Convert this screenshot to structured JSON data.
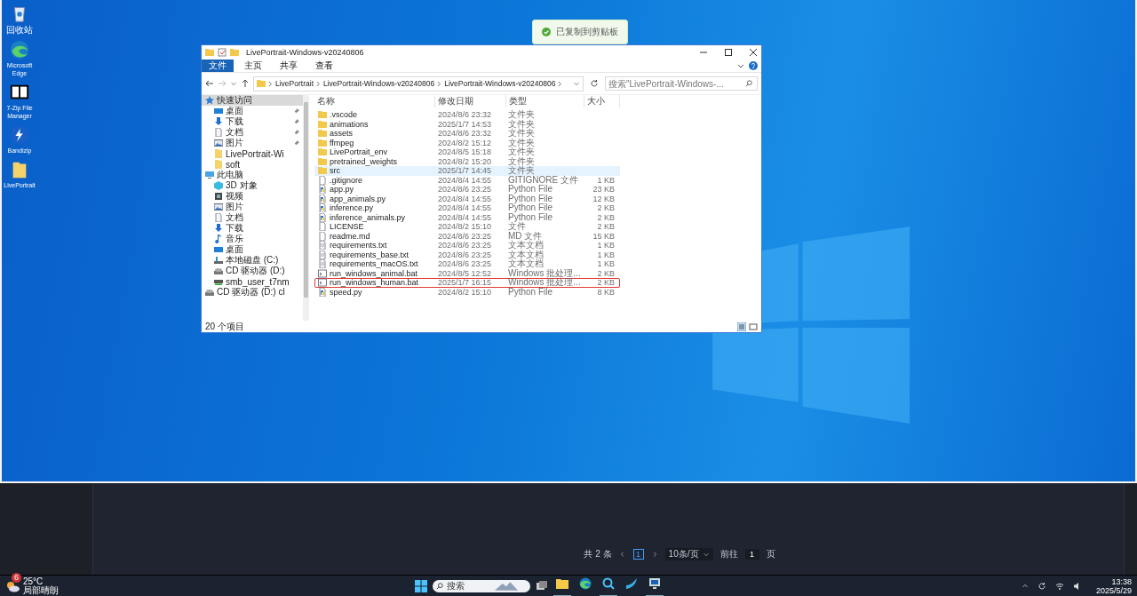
{
  "toast": {
    "text": "已复制到剪贴板"
  },
  "desktop_icons": [
    {
      "kind": "recycle",
      "label": "回收站"
    },
    {
      "kind": "edge",
      "label": "Microsoft Edge"
    },
    {
      "kind": "zip",
      "label": "7-Zip File Manager"
    },
    {
      "kind": "bandizip",
      "label": "Bandizip"
    },
    {
      "kind": "folder",
      "label": "LivePortrait"
    }
  ],
  "window": {
    "title": "LivePortrait-Windows-v20240806",
    "tabs": [
      {
        "label": "文件",
        "selected": true
      },
      {
        "label": "主页",
        "selected": false
      },
      {
        "label": "共享",
        "selected": false
      },
      {
        "label": "查看",
        "selected": false
      }
    ],
    "path": [
      "LivePortrait",
      "LivePortrait-Windows-v20240806",
      "LivePortrait-Windows-v20240806"
    ],
    "search": {
      "placeholder": "搜索\"LivePortrait-Windows-..."
    },
    "nav": [
      {
        "kind": "star",
        "label": "快速访问",
        "selected": true,
        "children": [
          {
            "kind": "desktop",
            "label": "桌面",
            "pinned": true
          },
          {
            "kind": "download",
            "label": "下载",
            "pinned": true
          },
          {
            "kind": "doc",
            "label": "文档",
            "pinned": true
          },
          {
            "kind": "picture",
            "label": "图片",
            "pinned": true
          },
          {
            "kind": "folder",
            "label": "LivePortrait-Wi",
            "pinned": false
          },
          {
            "kind": "folder",
            "label": "soft",
            "pinned": false
          }
        ]
      },
      {
        "kind": "pc",
        "label": "此电脑",
        "selected": false,
        "children": [
          {
            "kind": "cube",
            "label": "3D 对象"
          },
          {
            "kind": "video",
            "label": "视频"
          },
          {
            "kind": "picture",
            "label": "图片"
          },
          {
            "kind": "doc",
            "label": "文档"
          },
          {
            "kind": "download",
            "label": "下载"
          },
          {
            "kind": "music",
            "label": "音乐"
          },
          {
            "kind": "desktop",
            "label": "桌面"
          },
          {
            "kind": "disk",
            "label": "本地磁盘 (C:)"
          },
          {
            "kind": "cd",
            "label": "CD 驱动器 (D:)"
          },
          {
            "kind": "net",
            "label": "smb_user_t7nm"
          }
        ]
      },
      {
        "kind": "cd",
        "label": "CD 驱动器 (D:) cl",
        "selected": false
      }
    ],
    "columns": [
      "名称",
      "修改日期",
      "类型",
      "大小"
    ],
    "files": [
      {
        "kind": "folder",
        "name": ".vscode",
        "date": "2024/8/6 23:32",
        "type": "文件夹",
        "selected": false,
        "annotated": false
      },
      {
        "kind": "folder",
        "name": "animations",
        "date": "2025/1/7 14:53",
        "type": "文件夹",
        "selected": false,
        "annotated": false
      },
      {
        "kind": "folder",
        "name": "assets",
        "date": "2024/8/6 23:32",
        "type": "文件夹",
        "selected": false,
        "annotated": false
      },
      {
        "kind": "folder",
        "name": "ffmpeg",
        "date": "2024/8/2 15:12",
        "type": "文件夹",
        "selected": false,
        "annotated": false
      },
      {
        "kind": "folder",
        "name": "LivePortrait_env",
        "date": "2024/8/5 15:18",
        "type": "文件夹",
        "selected": false,
        "annotated": false
      },
      {
        "kind": "folder",
        "name": "pretrained_weights",
        "date": "2024/8/2 15:20",
        "type": "文件夹",
        "selected": false,
        "annotated": false
      },
      {
        "kind": "folder",
        "name": "src",
        "date": "2025/1/7 14:45",
        "type": "文件夹",
        "selected": true,
        "annotated": false
      },
      {
        "kind": "file",
        "name": ".gitignore",
        "date": "2024/8/4 14:55",
        "type": "GITIGNORE 文件",
        "size": "1 KB",
        "selected": false,
        "annotated": false
      },
      {
        "kind": "python",
        "name": "app.py",
        "date": "2024/8/6 23:25",
        "type": "Python File",
        "size": "23 KB",
        "selected": false,
        "annotated": false
      },
      {
        "kind": "python",
        "name": "app_animals.py",
        "date": "2024/8/4 14:55",
        "type": "Python File",
        "size": "12 KB",
        "selected": false,
        "annotated": false
      },
      {
        "kind": "python",
        "name": "inference.py",
        "date": "2024/8/4 14:55",
        "type": "Python File",
        "size": "2 KB",
        "selected": false,
        "annotated": false
      },
      {
        "kind": "python",
        "name": "inference_animals.py",
        "date": "2024/8/4 14:55",
        "type": "Python File",
        "size": "2 KB",
        "selected": false,
        "annotated": false
      },
      {
        "kind": "file",
        "name": "LICENSE",
        "date": "2024/8/2 15:10",
        "type": "文件",
        "size": "2 KB",
        "selected": false,
        "annotated": false
      },
      {
        "kind": "file",
        "name": "readme.md",
        "date": "2024/8/6 23:25",
        "type": "MD 文件",
        "size": "15 KB",
        "selected": false,
        "annotated": false
      },
      {
        "kind": "text",
        "name": "requirements.txt",
        "date": "2024/8/6 23:25",
        "type": "文本文档",
        "size": "1 KB",
        "selected": false,
        "annotated": false
      },
      {
        "kind": "text",
        "name": "requirements_base.txt",
        "date": "2024/8/6 23:25",
        "type": "文本文档",
        "size": "1 KB",
        "selected": false,
        "annotated": false
      },
      {
        "kind": "text",
        "name": "requirements_macOS.txt",
        "date": "2024/8/6 23:25",
        "type": "文本文档",
        "size": "1 KB",
        "selected": false,
        "annotated": false
      },
      {
        "kind": "bat",
        "name": "run_windows_animal.bat",
        "date": "2024/8/5 12:52",
        "type": "Windows 批处理...",
        "size": "2 KB",
        "selected": false,
        "annotated": false
      },
      {
        "kind": "bat",
        "name": "run_windows_human.bat",
        "date": "2025/1/7 16:15",
        "type": "Windows 批处理...",
        "size": "2 KB",
        "selected": false,
        "annotated": true
      },
      {
        "kind": "python",
        "name": "speed.py",
        "date": "2024/8/2 15:10",
        "type": "Python File",
        "size": "8 KB",
        "selected": false,
        "annotated": false
      }
    ],
    "status": "20 个项目"
  },
  "pagination": {
    "total": "共 2 条",
    "pages": [
      {
        "label": "1",
        "selected": true
      }
    ],
    "page_size": "10条/页",
    "goto_label": "前往",
    "goto_value": "1",
    "goto_suffix": "页"
  },
  "taskbar": {
    "temperature": "25°C",
    "weather": "局部晴朗",
    "weather_badge": "6",
    "search": {
      "placeholder": "搜索"
    },
    "apps": [
      {
        "kind": "explorer",
        "open": true
      },
      {
        "kind": "edge",
        "open": false
      },
      {
        "kind": "copilot",
        "open": true
      },
      {
        "kind": "bandizip",
        "open": false
      },
      {
        "kind": "app",
        "open": true
      }
    ],
    "time": "13:38",
    "date": "2025/5/29"
  }
}
